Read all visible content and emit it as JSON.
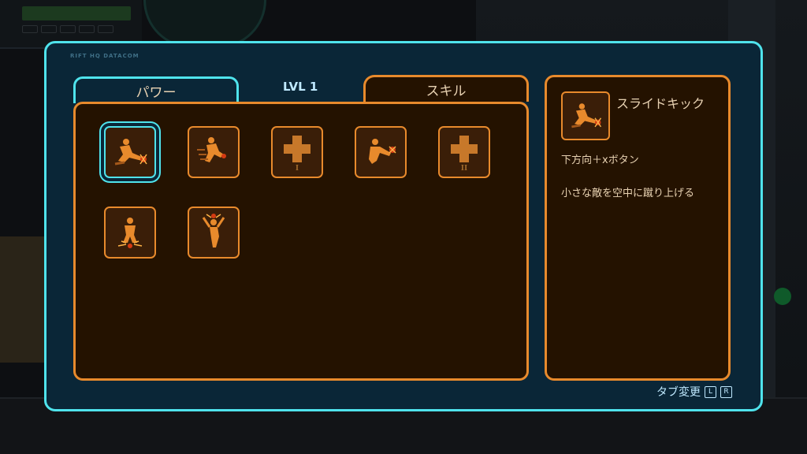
{
  "window": {
    "header_label": "RIFT HQ DATACOM",
    "level_label": "LVL 1"
  },
  "tabs": [
    {
      "label": "パワー",
      "active": false
    },
    {
      "label": "スキル",
      "active": true
    }
  ],
  "skills": [
    {
      "icon": "slide-kick-icon",
      "selected": true,
      "locked": false
    },
    {
      "icon": "dash-attack-icon",
      "selected": false,
      "locked": false
    },
    {
      "icon": "health-upgrade-icon",
      "selected": false,
      "locked": true,
      "tier": "I"
    },
    {
      "icon": "air-kick-icon",
      "selected": false,
      "locked": false
    },
    {
      "icon": "health-upgrade-icon",
      "selected": false,
      "locked": true,
      "tier": "II"
    },
    {
      "icon": "ground-slam-icon",
      "selected": false,
      "locked": false
    },
    {
      "icon": "uppercut-icon",
      "selected": false,
      "locked": false
    }
  ],
  "detail": {
    "icon": "slide-kick-icon",
    "name": "スライドキック",
    "input": "下方向＋xボタン",
    "description": "小さな敵を空中に蹴り上げる"
  },
  "footer": {
    "label": "タブ変更",
    "keys": [
      "L",
      "R"
    ]
  },
  "colors": {
    "accent_cyan": "#4fe3ec",
    "accent_orange": "#e88a2c",
    "panel_bg": "#241200",
    "frame_bg": "#0a2637"
  }
}
